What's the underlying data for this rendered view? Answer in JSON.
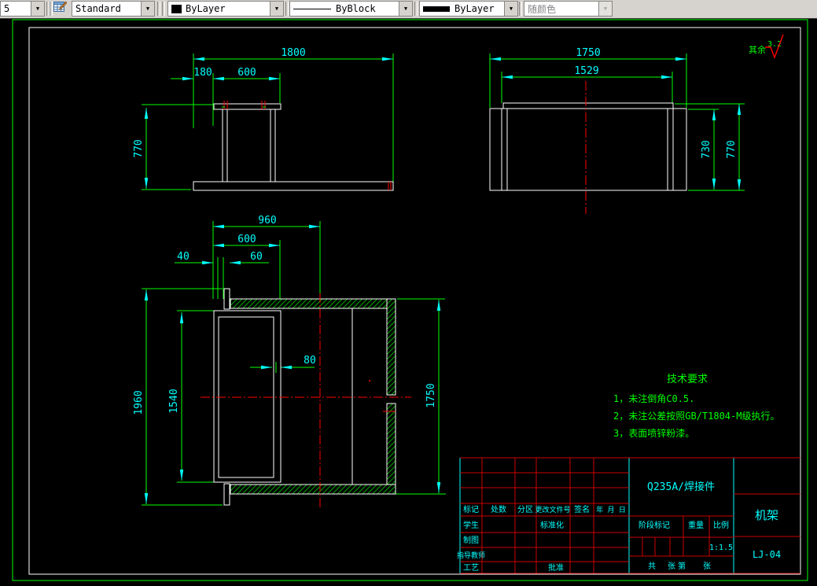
{
  "toolbar": {
    "scale_combo": "5",
    "style_combo": "Standard",
    "color_combo": "ByLayer",
    "linetype_combo": "ByBlock",
    "lineweight_combo": "ByLayer",
    "plotstyle_combo": "随颜色"
  },
  "surface_note": {
    "label": "其余",
    "value": "3.2"
  },
  "tech_requirements": {
    "title": "技术要求",
    "items": [
      "1，未注倒角C0.5.",
      "2，未注公差按照GB/T1804-M级执行。",
      "3，表面喷锌粉漆。"
    ]
  },
  "dims": {
    "front": {
      "total": "1800",
      "left": "180",
      "opening": "600",
      "height": "770"
    },
    "side": {
      "total": "1750",
      "inner": "1529",
      "inner_height": "730",
      "height": "770"
    },
    "plan": {
      "top": "960",
      "opening": "600",
      "d40": "40",
      "d60": "60",
      "d80": "80",
      "overall": "1960",
      "door": "1540",
      "frame": "1750"
    }
  },
  "title_block": {
    "rev_header": [
      "标记",
      "处数",
      "分区",
      "更改文件号",
      "签名",
      "年 月 日"
    ],
    "roles": {
      "student": "学生",
      "standardization": "标准化",
      "drafter": "制图",
      "advisor": "指导教师",
      "process": "工艺",
      "approve": "批准"
    },
    "material": "Q235A/焊接件",
    "stage_header": {
      "stage": "阶段标记",
      "weight": "重量",
      "scale": "比例"
    },
    "scale_value": "1:1.5",
    "sheet": {
      "total_label": "共",
      "sheet_label": "张",
      "page_label": "第",
      "page_label2": "张"
    },
    "part_name": "机架",
    "drawing_no": "LJ-04"
  },
  "colors": {
    "background": "#000000",
    "geometry": "#ffffff",
    "dimension_line": "#00ff00",
    "dimension_text": "#00ffff",
    "centerline": "#ff0000",
    "hatch": "#00cc00",
    "titleblock_grid": "#cc0000",
    "titleblock_text": "#00ffff",
    "annotation_text": "#00ff00",
    "toolbar_bg": "#d6d3ce"
  }
}
